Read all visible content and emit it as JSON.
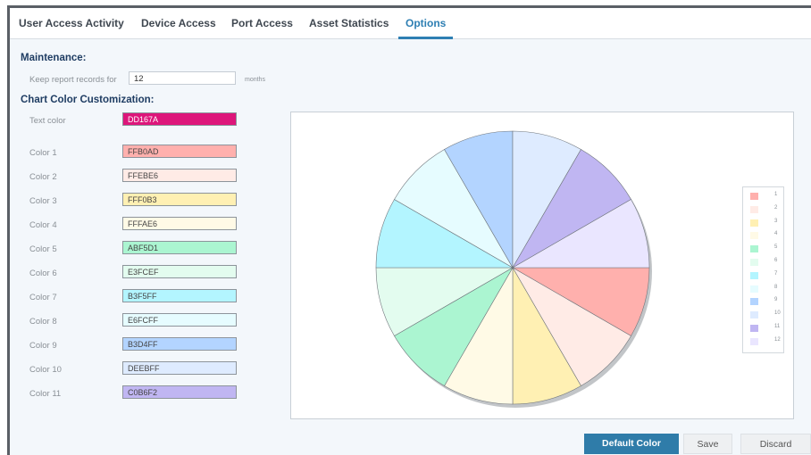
{
  "tabs": [
    {
      "label": "User Access Activity",
      "active": false
    },
    {
      "label": "Device Access",
      "active": false
    },
    {
      "label": "Port Access",
      "active": false
    },
    {
      "label": "Asset Statistics",
      "active": false
    },
    {
      "label": "Options",
      "active": true
    }
  ],
  "maintenance": {
    "title": "Maintenance:",
    "keep_label": "Keep report records for",
    "keep_value": "12",
    "unit": "months"
  },
  "customization": {
    "title": "Chart Color Customization:",
    "text_color": {
      "label": "Text color",
      "value": "DD167A",
      "hex": "#DD167A"
    },
    "colors": [
      {
        "label": "Color 1",
        "value": "FFB0AD",
        "hex": "#FFB0AD"
      },
      {
        "label": "Color 2",
        "value": "FFEBE6",
        "hex": "#FFEBE6"
      },
      {
        "label": "Color 3",
        "value": "FFF0B3",
        "hex": "#FFF0B3"
      },
      {
        "label": "Color 4",
        "value": "FFFAE6",
        "hex": "#FFFAE6"
      },
      {
        "label": "Color 5",
        "value": "ABF5D1",
        "hex": "#ABF5D1"
      },
      {
        "label": "Color 6",
        "value": "E3FCEF",
        "hex": "#E3FCEF"
      },
      {
        "label": "Color 7",
        "value": "B3F5FF",
        "hex": "#B3F5FF"
      },
      {
        "label": "Color 8",
        "value": "E6FCFF",
        "hex": "#E6FCFF"
      },
      {
        "label": "Color 9",
        "value": "B3D4FF",
        "hex": "#B3D4FF"
      },
      {
        "label": "Color 10",
        "value": "DEEBFF",
        "hex": "#DEEBFF"
      },
      {
        "label": "Color 11",
        "value": "C0B6F2",
        "hex": "#C0B6F2"
      }
    ]
  },
  "chart_data": {
    "type": "pie",
    "categories": [
      "1",
      "2",
      "3",
      "4",
      "5",
      "6",
      "7",
      "8",
      "9",
      "10",
      "11",
      "12"
    ],
    "values": [
      1,
      1,
      1,
      1,
      1,
      1,
      1,
      1,
      1,
      1,
      1,
      1
    ],
    "colors": [
      "#FFB0AD",
      "#FFEBE6",
      "#FFF0B3",
      "#FFFAE6",
      "#ABF5D1",
      "#E3FCEF",
      "#B3F5FF",
      "#E6FCFF",
      "#B3D4FF",
      "#DEEBFF",
      "#C0B6F2",
      "#EAE6FF"
    ],
    "legend": "right"
  },
  "buttons": {
    "default_color": "Default Color",
    "save": "Save",
    "discard": "Discard"
  }
}
